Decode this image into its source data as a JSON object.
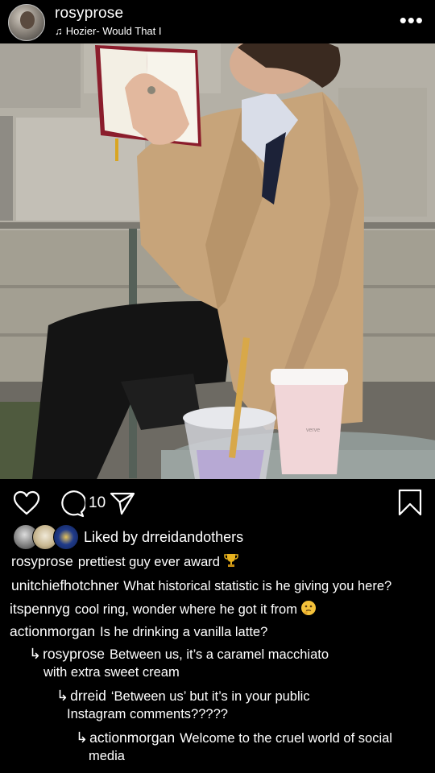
{
  "post": {
    "username": "rosyprose",
    "song": "Hozier- Would That I",
    "more_icon": "more-dots-icon",
    "comment_count": "10"
  },
  "likes": {
    "prefix": "Liked by ",
    "user": "drreid",
    "joiner": "and",
    "suffix": "others"
  },
  "comments": [
    {
      "user": "rosyprose",
      "text": "prettiest guy ever award",
      "emoji": "trophy-icon"
    },
    {
      "user": "unitchiefhotchner",
      "text": "What historical statistic is he giving you here?"
    },
    {
      "user": "itspennyg",
      "text": "cool ring, wonder where he got it from",
      "emoji": "thinking-face-icon"
    },
    {
      "user": "actionmorgan",
      "text": "Is he drinking a vanilla latte?"
    }
  ],
  "replies": [
    {
      "arrow": "↳",
      "user": "rosyprose",
      "line1": "Between us, it’s a caramel macchiato",
      "line2": "with extra sweet cream"
    },
    {
      "arrow": "↳",
      "user": "drreid",
      "line1": "‘Between us’ but it’s in your public",
      "line2": "Instagram comments?????"
    },
    {
      "arrow": "↳",
      "user": "actionmorgan",
      "line1": "Welcome to the cruel world of social",
      "line2": "media"
    }
  ],
  "colors": {
    "background": "#000000",
    "text": "#ffffff",
    "trophy": "#e8b21e"
  }
}
